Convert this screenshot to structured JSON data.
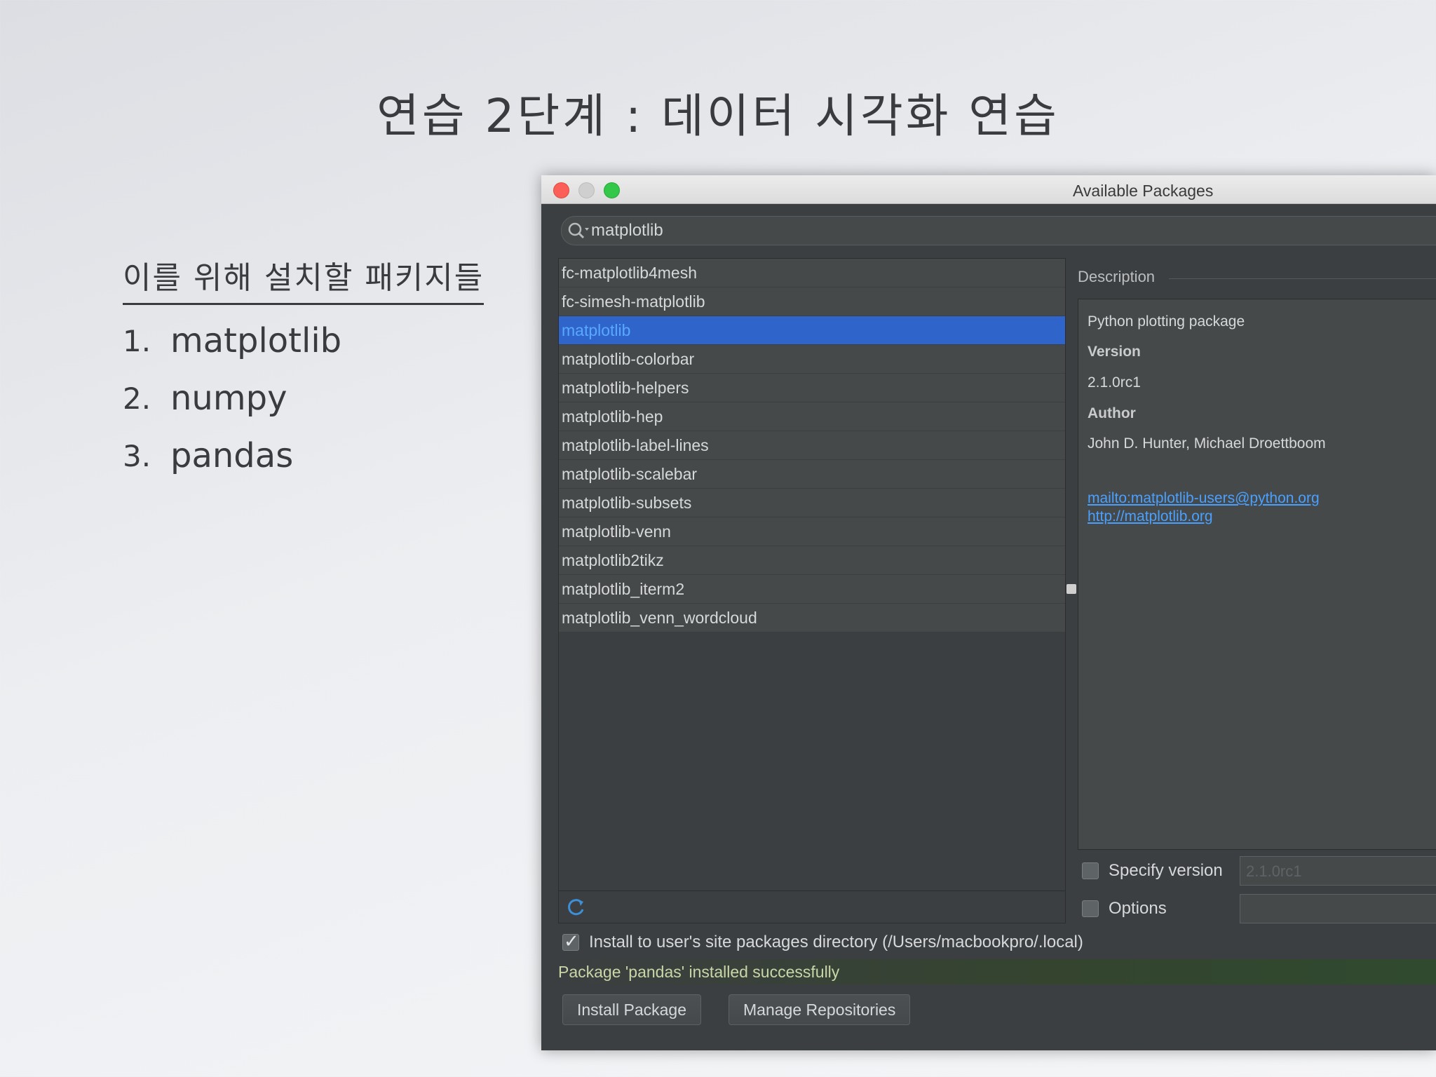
{
  "slide": {
    "title": "연습 2단계 : 데이터 시각화 연습",
    "heading": "이를 위해 설치할 패키지들",
    "items": [
      {
        "num": "1.",
        "label": "matplotlib"
      },
      {
        "num": "2.",
        "label": "numpy"
      },
      {
        "num": "3.",
        "label": "pandas"
      }
    ]
  },
  "window": {
    "title": "Available Packages",
    "search_value": "matplotlib",
    "packages": [
      "fc-matplotlib4mesh",
      "fc-simesh-matplotlib",
      "matplotlib",
      "matplotlib-colorbar",
      "matplotlib-helpers",
      "matplotlib-hep",
      "matplotlib-label-lines",
      "matplotlib-scalebar",
      "matplotlib-subsets",
      "matplotlib-venn",
      "matplotlib2tikz",
      "matplotlib_iterm2",
      "matplotlib_venn_wordcloud"
    ],
    "selected_package": "matplotlib",
    "description": {
      "label": "Description",
      "summary": "Python plotting package",
      "version_label": "Version",
      "version": "2.1.0rc1",
      "author_label": "Author",
      "author": "John D. Hunter, Michael Droettboom",
      "email_link": "mailto:matplotlib-users@python.org",
      "home_link": "http://matplotlib.org"
    },
    "specify_version_label": "Specify version",
    "specify_version_value": "2.1.0rc1",
    "options_label": "Options",
    "install_to_user_label": "Install to user's site packages directory (/Users/macbookpro/.local)",
    "install_to_user_checked": true,
    "status": "Package 'pandas' installed successfully",
    "install_button": "Install Package",
    "manage_button": "Manage Repositories"
  }
}
